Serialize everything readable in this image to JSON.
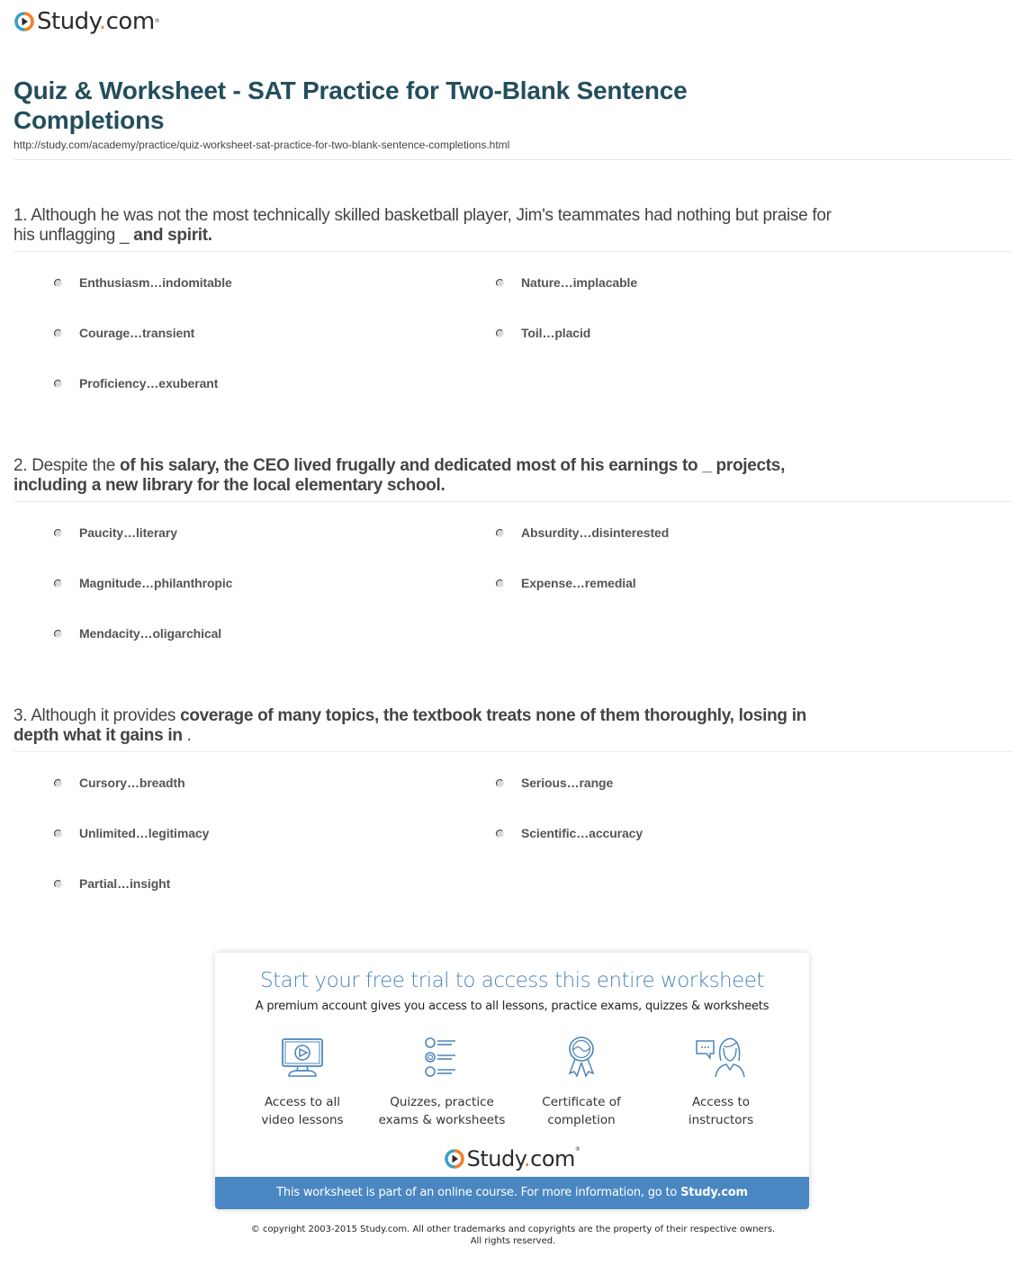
{
  "brand": {
    "name_main": "Study",
    "name_dot": ".",
    "name_tld": "com",
    "trademark": "®",
    "colors": {
      "ring_teal": "#3aa0c8",
      "ring_orange": "#f58026",
      "title": "#234e5c",
      "accent_blue": "#4a87c2"
    }
  },
  "header": {
    "title": "Quiz & Worksheet - SAT Practice for Two-Blank Sentence Completions",
    "url": "http://study.com/academy/practice/quiz-worksheet-sat-practice-for-two-blank-sentence-completions.html"
  },
  "questions": [
    {
      "number": "1.",
      "text_plain": "Although he was not the most technically skilled basketball player, Jim's teammates had nothing but praise for his unflagging _",
      "text_bold": "and spirit.",
      "options": [
        "Enthusiasm…indomitable",
        "Nature…implacable",
        "Courage…transient",
        "Toil…placid",
        "Proficiency…exuberant"
      ]
    },
    {
      "number": "2.",
      "text_plain": "Despite the",
      "text_bold": "of his salary, the CEO lived frugally and dedicated most of his earnings to _ projects, including a new library for the local elementary school.",
      "options": [
        "Paucity…literary",
        "Absurdity…disinterested",
        "Magnitude…philanthropic",
        "Expense…remedial",
        "Mendacity…oligarchical"
      ]
    },
    {
      "number": "3.",
      "text_plain": "Although it provides",
      "text_bold": "coverage of many topics, the textbook treats none of them thoroughly, losing in depth what it gains in",
      "text_tail": ".",
      "options": [
        "Cursory…breadth",
        "Serious…range",
        "Unlimited…legitimacy",
        "Scientific…accuracy",
        "Partial…insight"
      ]
    }
  ],
  "promo": {
    "title": "Start your free trial to access this entire worksheet",
    "subtitle": "A premium account gives you access to all lessons, practice exams, quizzes & worksheets",
    "features": [
      {
        "icon": "monitor-play-icon",
        "line1": "Access to all",
        "line2": "video lessons"
      },
      {
        "icon": "quiz-list-icon",
        "line1": "Quizzes, practice",
        "line2": "exams & worksheets"
      },
      {
        "icon": "certificate-ribbon-icon",
        "line1": "Certificate of",
        "line2": "completion"
      },
      {
        "icon": "instructor-chat-icon",
        "line1": "Access to",
        "line2": "instructors"
      }
    ],
    "footer_text": "This worksheet is part of an online course. For more information, go to",
    "footer_link": "Study.com"
  },
  "copyright": {
    "line1": "© copyright 2003-2015 Study.com. All other trademarks and copyrights are the property of their respective owners.",
    "line2": "All rights reserved."
  }
}
